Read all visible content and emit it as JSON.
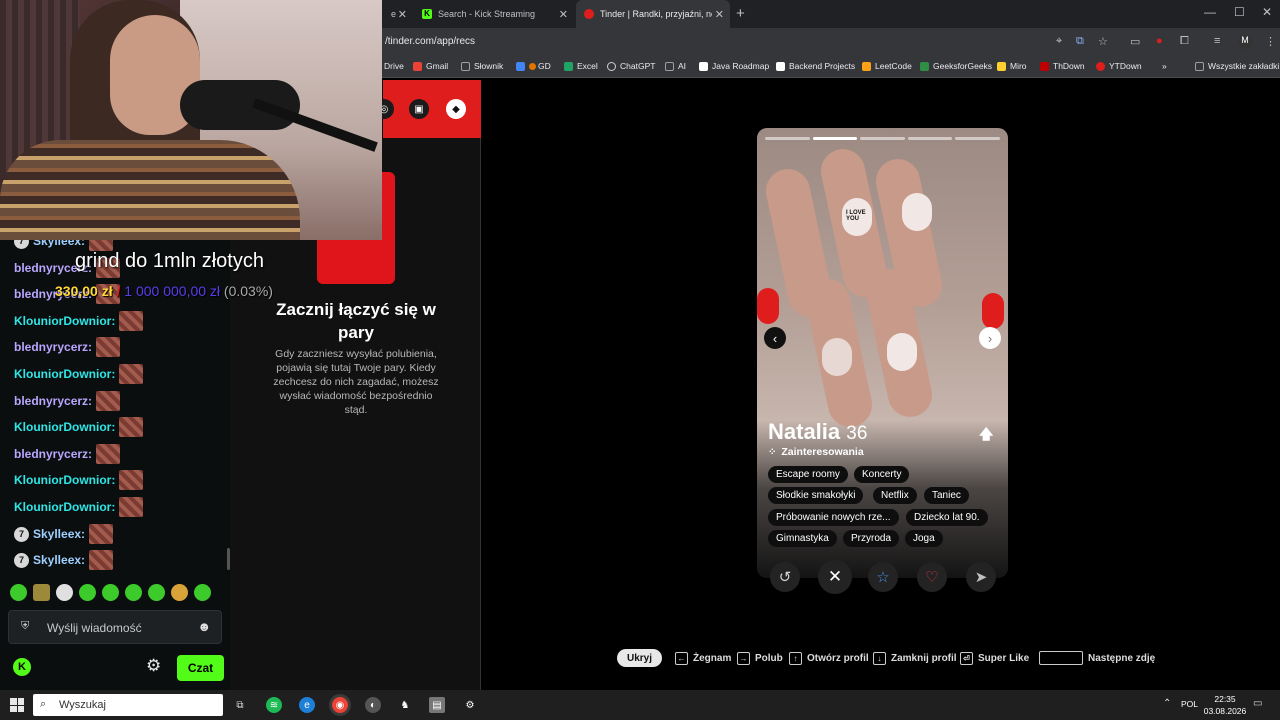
{
  "browser": {
    "tabs": [
      {
        "title": "e",
        "favicon_color": "#4285f4"
      },
      {
        "title": "Search - Kick Streaming",
        "favicon_color": "#53fc18"
      },
      {
        "title": "Tinder | Randki, przyjaźni, nowe",
        "favicon_color": "#e01d1d"
      }
    ],
    "url": "/tinder.com/app/recs",
    "bookmarks": [
      {
        "label": "Drive",
        "color": "#fbbc04"
      },
      {
        "label": "Gmail",
        "color": "#ea4335"
      },
      {
        "label": "Słownik",
        "color": "#9aa0a6"
      },
      {
        "label": "GD",
        "color": "#4285f4"
      },
      {
        "label": "Excel",
        "color": "#21a366"
      },
      {
        "label": "ChatGPT",
        "color": "#d0d0d0"
      },
      {
        "label": "AI",
        "color": "#9aa0a6"
      },
      {
        "label": "Java Roadmap",
        "color": "#202124"
      },
      {
        "label": "Backend Projects",
        "color": "#202124"
      },
      {
        "label": "LeetCode",
        "color": "#ffa116"
      },
      {
        "label": "GeeksforGeeks",
        "color": "#2f8d46"
      },
      {
        "label": "Miro",
        "color": "#ffd02f"
      },
      {
        "label": "ThDown",
        "color": "#c00000"
      },
      {
        "label": "YTDown",
        "color": "#e01d1d"
      },
      {
        "label": "Wszystkie zakładki",
        "color": "#9aa0a6"
      }
    ],
    "chevron": "»"
  },
  "stream": {
    "goal_title": "grind do 1mln złotych",
    "goal_current": "330,00 zł",
    "goal_separator": "/",
    "goal_target": "1 000 000,00 zł",
    "goal_percent": "(0.03%)"
  },
  "chat": {
    "messages": [
      {
        "user": "Skylleex:",
        "color": "#9fd0ff",
        "badge": "7"
      },
      {
        "user": "blednyrycerz:",
        "color": "#b9a6ff",
        "badge": ""
      },
      {
        "user": "blednyrycerz:",
        "color": "#b9a6ff",
        "badge": ""
      },
      {
        "user": "KlouniorDownior:",
        "color": "#2ee6e6",
        "badge": ""
      },
      {
        "user": "blednyrycerz:",
        "color": "#b9a6ff",
        "badge": ""
      },
      {
        "user": "KlouniorDownior:",
        "color": "#2ee6e6",
        "badge": ""
      },
      {
        "user": "blednyrycerz:",
        "color": "#b9a6ff",
        "badge": ""
      },
      {
        "user": "KlouniorDownior:",
        "color": "#2ee6e6",
        "badge": ""
      },
      {
        "user": "blednyrycerz:",
        "color": "#b9a6ff",
        "badge": ""
      },
      {
        "user": "KlouniorDownior:",
        "color": "#2ee6e6",
        "badge": ""
      },
      {
        "user": "KlouniorDownior:",
        "color": "#2ee6e6",
        "badge": ""
      },
      {
        "user": "Skylleex:",
        "color": "#9fd0ff",
        "badge": "7"
      },
      {
        "user": "Skylleex:",
        "color": "#9fd0ff",
        "badge": "7"
      }
    ],
    "input_placeholder": "Wyślij wiadomość",
    "send_label": "Czat"
  },
  "tinder": {
    "matches_title": "Zacznij łączyć się w pary",
    "matches_desc": "Gdy zaczniesz wysyłać polubienia, pojawią się tutaj Twoje pary. Kiedy zechcesz do nich zagadać, możesz wysłać wiadomość bezpośrednio stąd.",
    "profile": {
      "name": "Natalia",
      "age": "36",
      "interests_label": "Zainteresowania",
      "nail_text": "I LOVE YOU",
      "interests": [
        "Escape roomy",
        "Koncerty",
        "Słodkie smakołyki",
        "Netflix",
        "Taniec",
        "Próbowanie nowych rze...",
        "Dziecko lat 90.",
        "Gimnastyka",
        "Przyroda",
        "Joga"
      ],
      "photo_count": 5,
      "active_photo": 1
    },
    "actions": [
      {
        "name": "rewind-button",
        "icon": "rewind-icon",
        "glyph": "↺",
        "color": "#d0d0d0"
      },
      {
        "name": "nope-button",
        "icon": "close-icon",
        "glyph": "✕",
        "color": "#ffffff"
      },
      {
        "name": "super-like-button",
        "icon": "star-icon",
        "glyph": "☆",
        "color": "#4a90e2"
      },
      {
        "name": "like-button",
        "icon": "heart-icon",
        "glyph": "♡",
        "color": "#e0304a"
      },
      {
        "name": "boost-button",
        "icon": "send-icon",
        "glyph": "➤",
        "color": "#c0c0c0"
      }
    ],
    "shortcuts": {
      "hide": "Ukryj",
      "items": [
        {
          "key": "←",
          "label": "Żegnam"
        },
        {
          "key": "→",
          "label": "Polub"
        },
        {
          "key": "↑",
          "label": "Otwórz profil"
        },
        {
          "key": "↓",
          "label": "Zamknij profil"
        },
        {
          "key": "⏎",
          "label": "Super Like"
        }
      ],
      "space_label": "Następne zdję"
    }
  },
  "taskbar": {
    "search_placeholder": "Wyszukaj",
    "language": "POL",
    "time": "22:35",
    "date": "03.08.2026"
  }
}
